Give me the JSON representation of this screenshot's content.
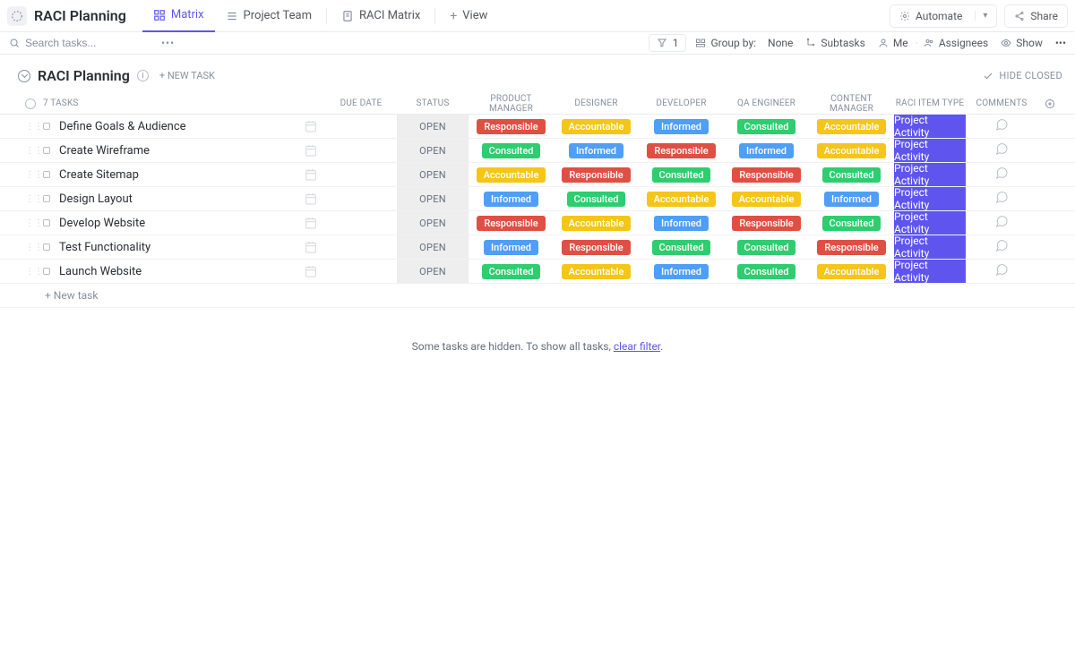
{
  "space_name": "RACI Planning",
  "tabs": [
    {
      "label": "Matrix",
      "active": true
    },
    {
      "label": "Project Team",
      "active": false
    },
    {
      "label": "RACI Matrix",
      "active": false
    }
  ],
  "view_button": "View",
  "automate_label": "Automate",
  "share_label": "Share",
  "search_placeholder": "Search tasks...",
  "filter_count": "1",
  "group_by_label": "Group by:",
  "group_by_value": "None",
  "subtasks_label": "Subtasks",
  "me_label": "Me",
  "assignees_label": "Assignees",
  "show_label": "Show",
  "section_title": "RACI Planning",
  "new_task_head": "+ NEW TASK",
  "hide_closed": "HIDE CLOSED",
  "task_count_label": "7 TASKS",
  "columns": {
    "due": "DUE DATE",
    "status": "STATUS",
    "pm": "PRODUCT MANAGER",
    "design": "DESIGNER",
    "dev": "DEVELOPER",
    "qa": "QA ENGINEER",
    "cm": "CONTENT MANAGER",
    "raci": "RACI ITEM TYPE",
    "comments": "COMMENTS"
  },
  "status_open": "OPEN",
  "raci_value": "Project Activity",
  "badge_labels": {
    "responsible": "Responsible",
    "accountable": "Accountable",
    "informed": "Informed",
    "consulted": "Consulted"
  },
  "tasks": [
    {
      "name": "Define Goals & Audience",
      "pm": "responsible",
      "design": "accountable",
      "dev": "informed",
      "qa": "consulted",
      "cm": "accountable"
    },
    {
      "name": "Create Wireframe",
      "pm": "consulted",
      "design": "informed",
      "dev": "responsible",
      "qa": "informed",
      "cm": "accountable"
    },
    {
      "name": "Create Sitemap",
      "pm": "accountable",
      "design": "responsible",
      "dev": "consulted",
      "qa": "responsible",
      "cm": "consulted"
    },
    {
      "name": "Design Layout",
      "pm": "informed",
      "design": "consulted",
      "dev": "accountable",
      "qa": "accountable",
      "cm": "informed"
    },
    {
      "name": "Develop Website",
      "pm": "responsible",
      "design": "accountable",
      "dev": "informed",
      "qa": "responsible",
      "cm": "consulted"
    },
    {
      "name": "Test Functionality",
      "pm": "informed",
      "design": "responsible",
      "dev": "consulted",
      "qa": "consulted",
      "cm": "responsible"
    },
    {
      "name": "Launch Website",
      "pm": "consulted",
      "design": "accountable",
      "dev": "informed",
      "qa": "consulted",
      "cm": "accountable"
    }
  ],
  "new_task_row": "+ New task",
  "filter_msg_prefix": "Some tasks are hidden. To show all tasks, ",
  "filter_msg_link": "clear filter",
  "filter_msg_suffix": "."
}
